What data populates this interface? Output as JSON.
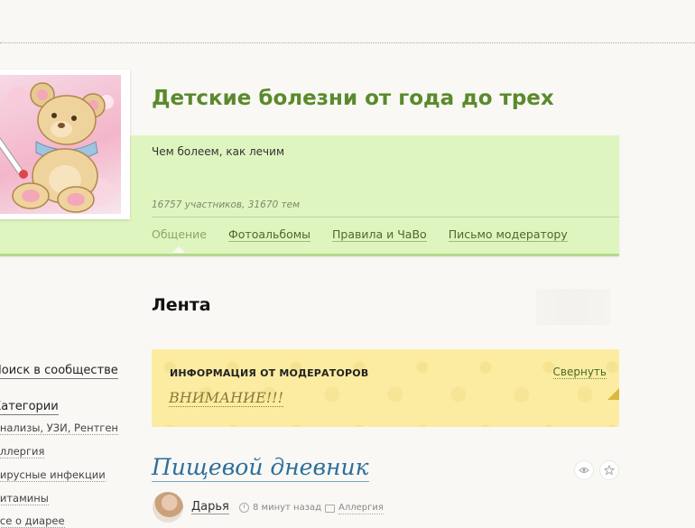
{
  "community": {
    "title": "Детские болезни от года до трех",
    "description": "Чем болеем, как лечим",
    "stats": "16757 участников, 31670 тем",
    "nav": [
      {
        "label": "Общение",
        "active": true
      },
      {
        "label": "Фотоальбомы",
        "active": false
      },
      {
        "label": "Правила и ЧаВо",
        "active": false
      },
      {
        "label": "Письмо модератору",
        "active": false
      }
    ],
    "avatar_icon": "teddy-bear-thermometer-icon"
  },
  "feed": {
    "title": "Лента"
  },
  "sidebar": {
    "search_label": "Поиск в сообществе",
    "categories_title": "Категории",
    "categories": [
      "Анализы, УЗИ, Рентген",
      "Аллергия",
      "Вирусные инфекции",
      "Витамины",
      "Все о диарее"
    ]
  },
  "moderator_box": {
    "title": "ИНФОРМАЦИЯ ОТ МОДЕРАТОРОВ",
    "collapse_label": "Свернуть",
    "warning": "ВНИМАНИЕ!!!"
  },
  "post": {
    "title": "Пищевой дневник",
    "author": "Дарья",
    "time": "8 минут назад",
    "category": "Аллергия",
    "view_icon": "eye-icon",
    "favorite_icon": "star-icon"
  },
  "colors": {
    "title_green": "#5a8a2c",
    "panel_green": "#dff5c0",
    "moderator_yellow": "#fbeca2",
    "post_title_blue": "#2b6f9c"
  }
}
